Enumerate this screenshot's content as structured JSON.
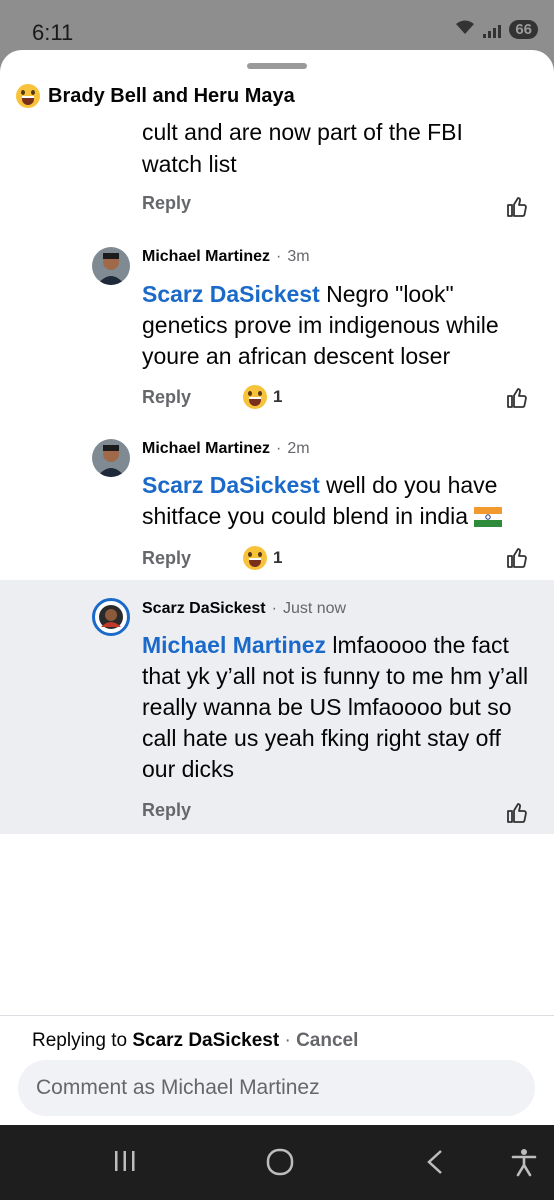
{
  "status": {
    "time": "6:11",
    "battery": "66"
  },
  "header": {
    "reactors": "Brady Bell and Heru Maya",
    "reaction_icon": "laughing-emoji"
  },
  "top_comment": {
    "text_lines": [
      "cult and are now part of the FBI",
      "watch list"
    ],
    "reply_label": "Reply"
  },
  "comments": [
    {
      "author": "Michael Martinez",
      "time": "3m",
      "mention": "Scarz DaSickest",
      "text": " Negro \"look\" genetics prove im indigenous while youre an african descent loser",
      "reply_label": "Reply",
      "reaction_count": "1"
    },
    {
      "author": "Michael Martinez",
      "time": "2m",
      "mention": "Scarz DaSickest",
      "text": " well do you have shitface you could blend in india",
      "flag": "india-flag",
      "reply_label": "Reply",
      "reaction_count": "1"
    },
    {
      "author": "Scarz DaSickest",
      "time": "Just now",
      "mention": "Michael Martinez",
      "text": " lmfaoooo the fact that yk y’all not is funny to me hm y’all really wanna be US lmfaoooo but so call hate us yeah fking right stay off our dicks",
      "reply_label": "Reply"
    }
  ],
  "footer": {
    "replying_prefix": "Replying to ",
    "replying_to": "Scarz DaSickest",
    "separator": " · ",
    "cancel": "Cancel",
    "placeholder": "Comment as Michael Martinez"
  },
  "colors": {
    "accent": "#1b6ac9",
    "muted": "#65676b",
    "highlight": "#eceef2"
  }
}
